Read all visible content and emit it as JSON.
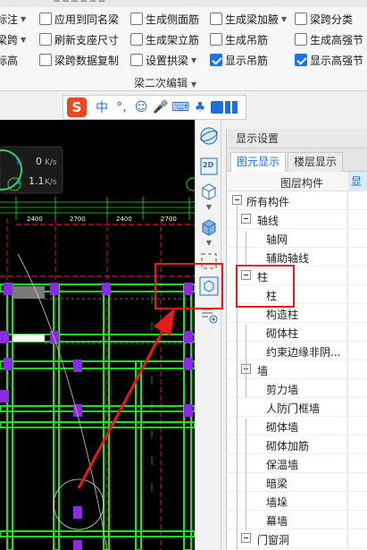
{
  "ribbon": {
    "rows": [
      [
        {
          "label": "标注",
          "icon": "annotation-icon",
          "dropdown": true
        },
        {
          "label": "应用到同名梁",
          "icon": "apply-same-name-icon"
        },
        {
          "label": "生成侧面筋",
          "icon": "side-rebar-icon"
        },
        {
          "label": "生成梁加腋",
          "icon": "beam-haunch-icon",
          "dropdown": true
        },
        {
          "label": "梁跨分类",
          "icon": "span-classify-icon"
        }
      ],
      [
        {
          "label": "梁跨",
          "icon": "beam-span-icon",
          "dropdown": true
        },
        {
          "label": "刷新支座尺寸",
          "icon": "refresh-support-icon"
        },
        {
          "label": "生成架立筋",
          "icon": "erection-rebar-icon"
        },
        {
          "label": "生成吊筋",
          "icon": "hanger-rebar-icon"
        },
        {
          "label": "生成高强节",
          "icon": "high-strength-icon"
        }
      ],
      [
        {
          "label": "标高",
          "icon": "elevation-icon"
        },
        {
          "label": "梁跨数据复制",
          "icon": "span-copy-icon"
        },
        {
          "label": "设置拱梁",
          "icon": "arch-beam-icon",
          "dropdown": true
        },
        {
          "label": "显示吊筋",
          "icon": "checkbox-icon",
          "checked": true
        },
        {
          "label": "显示高强节",
          "icon": "checkbox-icon",
          "checked": true
        }
      ]
    ],
    "group_name": "梁二次编辑"
  },
  "ime_toolbar": {
    "logo": "S",
    "items": [
      "中",
      "°,",
      "☺",
      "mic-icon",
      "keyboard-icon",
      "skin-icon",
      "shirt-icon",
      "grid-icon"
    ]
  },
  "canvas": {
    "speed_up": "0",
    "speed_down": "1.1",
    "speed_unit": "K/s",
    "dim_labels": [
      "2400",
      "2700",
      "2400",
      "2700"
    ]
  },
  "view_toolbar": {
    "items": [
      "orbit-icon",
      "2d-view-icon",
      "3d-box-icon",
      "3d-filled-box-icon",
      "select-frame-icon",
      "component-view-icon",
      "layer-display-icon"
    ],
    "label_2d": "2D"
  },
  "display_panel": {
    "title": "显示设置",
    "tabs": [
      "图元显示",
      "楼层显示"
    ],
    "active_tab": 0,
    "columns": [
      "图层构件",
      "显示"
    ],
    "tree": [
      {
        "label": "所有构件",
        "level": 0,
        "expandable": true
      },
      {
        "label": "轴线",
        "level": 1,
        "expandable": true
      },
      {
        "label": "轴网",
        "level": 2
      },
      {
        "label": "辅助轴线",
        "level": 2
      },
      {
        "label": "柱",
        "level": 1,
        "expandable": true
      },
      {
        "label": "柱",
        "level": 2
      },
      {
        "label": "构造柱",
        "level": 2
      },
      {
        "label": "砌体柱",
        "level": 2
      },
      {
        "label": "约束边缘非阴...",
        "level": 2
      },
      {
        "label": "墙",
        "level": 1,
        "expandable": true
      },
      {
        "label": "剪力墙",
        "level": 2
      },
      {
        "label": "人防门框墙",
        "level": 2
      },
      {
        "label": "砌体墙",
        "level": 2
      },
      {
        "label": "砌体加筋",
        "level": 2
      },
      {
        "label": "保温墙",
        "level": 2
      },
      {
        "label": "暗梁",
        "level": 2
      },
      {
        "label": "墙垛",
        "level": 2
      },
      {
        "label": "幕墙",
        "level": 2
      },
      {
        "label": "门窗洞",
        "level": 1,
        "expandable": true
      }
    ]
  },
  "colors": {
    "accent": "#1a73e8",
    "highlight_red": "#e51b1b",
    "beam_green": "#1ee31e",
    "column_purple": "#8a2be2",
    "canvas_bg": "#000000"
  }
}
